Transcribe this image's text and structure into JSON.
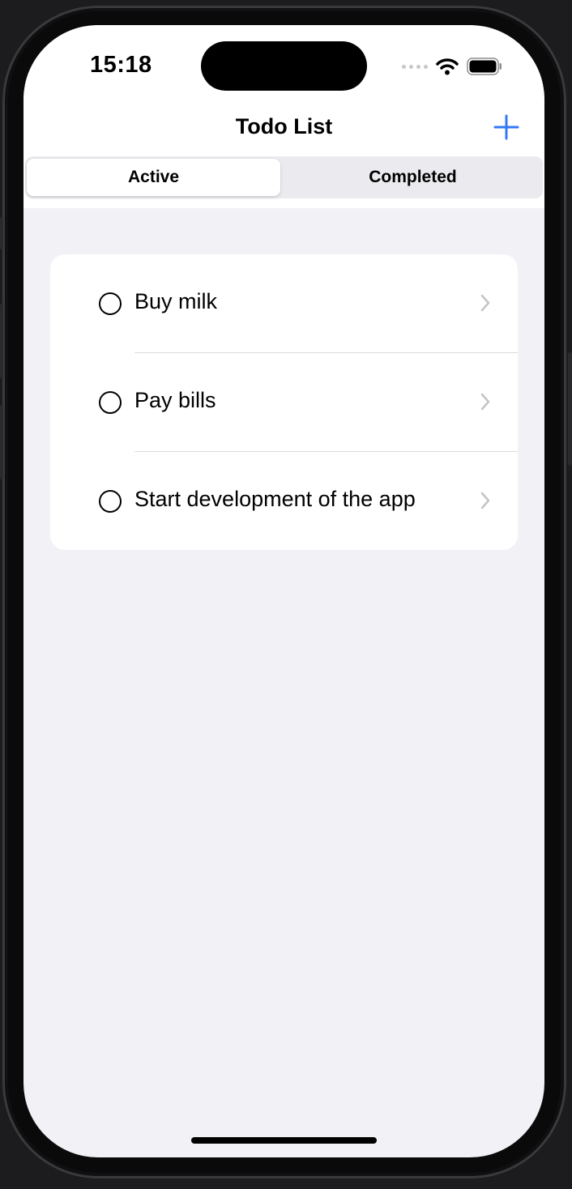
{
  "status_bar": {
    "time": "15:18"
  },
  "nav": {
    "title": "Todo List",
    "add_icon": "plus-icon"
  },
  "segments": [
    {
      "label": "Active",
      "selected": true
    },
    {
      "label": "Completed",
      "selected": false
    }
  ],
  "todos": [
    {
      "title": "Buy milk",
      "done": false
    },
    {
      "title": "Pay bills",
      "done": false
    },
    {
      "title": "Start development of the app",
      "done": false
    }
  ],
  "colors": {
    "accent": "#3478f6",
    "background": "#f1f1f6",
    "card": "#ffffff",
    "chevron": "#c4c4c7"
  }
}
